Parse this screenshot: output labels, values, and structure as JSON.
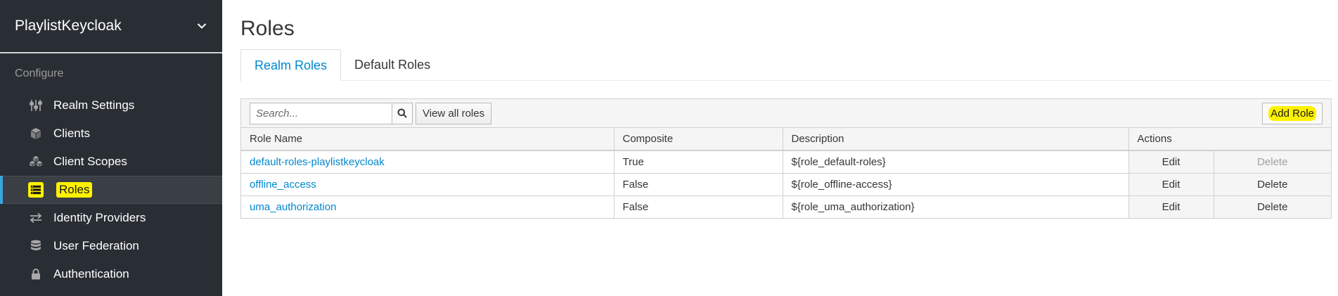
{
  "sidebar": {
    "realm_name": "PlaylistKeycloak",
    "section_label": "Configure",
    "items": [
      {
        "label": "Realm Settings",
        "icon": "sliders-icon"
      },
      {
        "label": "Clients",
        "icon": "cube-icon"
      },
      {
        "label": "Client Scopes",
        "icon": "cubes-icon"
      },
      {
        "label": "Roles",
        "icon": "list-icon",
        "active": true
      },
      {
        "label": "Identity Providers",
        "icon": "exchange-icon"
      },
      {
        "label": "User Federation",
        "icon": "database-icon"
      },
      {
        "label": "Authentication",
        "icon": "lock-icon"
      }
    ]
  },
  "main": {
    "title": "Roles",
    "tabs": [
      {
        "label": "Realm Roles",
        "active": true
      },
      {
        "label": "Default Roles",
        "active": false
      }
    ],
    "toolbar": {
      "search_placeholder": "Search...",
      "view_all_label": "View all roles",
      "add_role_label": "Add Role"
    },
    "table": {
      "headers": [
        "Role Name",
        "Composite",
        "Description",
        "Actions"
      ],
      "rows": [
        {
          "name": "default-roles-playlistkeycloak",
          "composite": "True",
          "description": "${role_default-roles}",
          "edit": "Edit",
          "delete": "Delete",
          "delete_disabled": true
        },
        {
          "name": "offline_access",
          "composite": "False",
          "description": "${role_offline-access}",
          "edit": "Edit",
          "delete": "Delete",
          "delete_disabled": false
        },
        {
          "name": "uma_authorization",
          "composite": "False",
          "description": "${role_uma_authorization}",
          "edit": "Edit",
          "delete": "Delete",
          "delete_disabled": false
        }
      ]
    }
  },
  "colors": {
    "sidebar_bg": "#292e34",
    "accent": "#0088ce",
    "active_indicator": "#39a5dc",
    "highlight": "#fff200"
  }
}
